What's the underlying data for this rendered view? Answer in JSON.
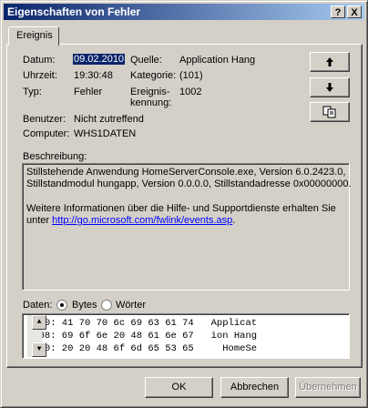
{
  "window": {
    "title": "Eigenschaften von Fehler",
    "help_button": "?",
    "close_button": "X"
  },
  "tabs": [
    {
      "label": "Ereignis"
    }
  ],
  "event": {
    "date_label": "Datum:",
    "date_value": "09.02.2010",
    "time_label": "Uhrzeit:",
    "time_value": "19:30:48",
    "type_label": "Typ:",
    "type_value": "Fehler",
    "user_label": "Benutzer:",
    "user_value": "Nicht zutreffend",
    "computer_label": "Computer:",
    "computer_value": "WHS1DATEN",
    "source_label": "Quelle:",
    "source_value": "Application Hang",
    "category_label": "Kategorie:",
    "category_value": "(101)",
    "id_label_1": "Ereignis-",
    "id_label_2": "kennung:",
    "id_value": "1002"
  },
  "nav_buttons": {
    "up_icon": "arrow-up",
    "down_icon": "arrow-down",
    "copy_icon": "copy"
  },
  "description": {
    "label": "Beschreibung:",
    "line1": "Stillstehende Anwendung HomeServerConsole.exe, Version 6.0.2423.0,",
    "line2": "Stillstandmodul hungapp, Version 0.0.0.0, Stillstandadresse 0x00000000.",
    "line3": "Weitere Informationen über die Hilfe- und Supportdienste erhalten Sie",
    "line4_prefix": "unter ",
    "link": "http://go.microsoft.com/fwlink/events.asp",
    "line4_suffix": "."
  },
  "data": {
    "label": "Daten:",
    "option_bytes": "Bytes",
    "option_words": "Wörter",
    "selected": "Bytes",
    "rows": [
      "0000: 41 70 70 6c 69 63 61 74   Applicat",
      "0008: 69 6f 6e 20 48 61 6e 67   ion Hang",
      "0010: 20 20 48 6f 6d 65 53 65     HomeSe"
    ]
  },
  "footer": {
    "ok": "OK",
    "cancel": "Abbrechen",
    "apply": "Übernehmen"
  }
}
